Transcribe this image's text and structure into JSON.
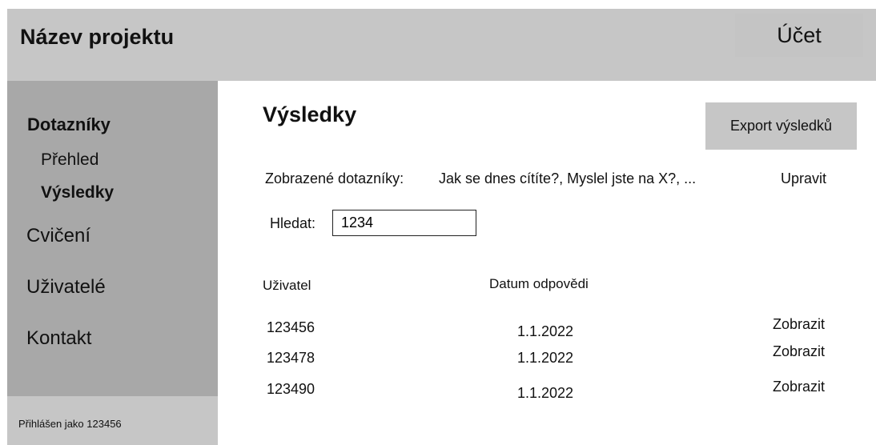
{
  "header": {
    "title": "Název projektu",
    "account": "Účet"
  },
  "sidebar": {
    "section": "Dotazníky",
    "sub_items": [
      "Přehled",
      "Výsledky"
    ],
    "items": [
      "Cvičení",
      "Uživatelé",
      "Kontakt"
    ],
    "footer": "Přihlášen jako 123456"
  },
  "main": {
    "title": "Výsledky",
    "export_label": "Export výsledků",
    "filter": {
      "label": "Zobrazené dotazníky:",
      "value": "Jak se dnes cítíte?, Myslel jste na X?, ...",
      "edit": "Upravit"
    },
    "search": {
      "label": "Hledat:",
      "value": "1234"
    },
    "table": {
      "headers": [
        "Uživatel",
        "Datum odpovědi"
      ],
      "rows": [
        {
          "user": "123456",
          "date": "1.1.2022",
          "action": "Zobrazit"
        },
        {
          "user": "123478",
          "date": "1.1.2022",
          "action": "Zobrazit"
        },
        {
          "user": "123490",
          "date": "1.1.2022",
          "action": "Zobrazit"
        }
      ]
    }
  }
}
